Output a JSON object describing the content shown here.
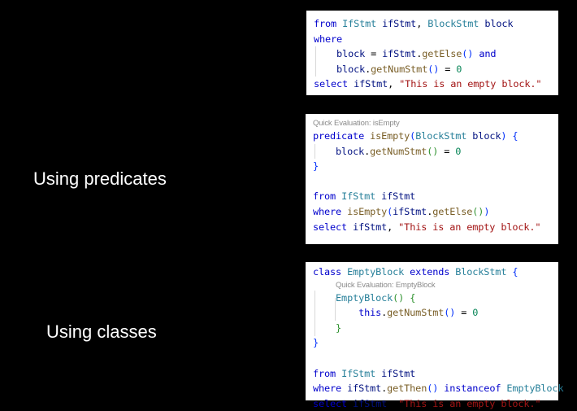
{
  "labels": {
    "predicates": "Using predicates",
    "classes": "Using classes"
  },
  "panel1": {
    "lines": [
      [
        [
          "kw",
          "from"
        ],
        [
          "op",
          " "
        ],
        [
          "ty",
          "IfStmt"
        ],
        [
          "op",
          " "
        ],
        [
          "id",
          "ifStmt"
        ],
        [
          "op",
          ", "
        ],
        [
          "ty",
          "BlockStmt"
        ],
        [
          "op",
          " "
        ],
        [
          "id",
          "block"
        ]
      ],
      [
        [
          "kw",
          "where"
        ]
      ],
      [
        [
          "op",
          "    "
        ],
        [
          "id",
          "block"
        ],
        [
          "op",
          " = "
        ],
        [
          "id",
          "ifStmt"
        ],
        [
          "op",
          "."
        ],
        [
          "fn",
          "getElse"
        ],
        [
          "b1",
          "()"
        ],
        [
          "op",
          " "
        ],
        [
          "kw",
          "and"
        ]
      ],
      [
        [
          "op",
          "    "
        ],
        [
          "id",
          "block"
        ],
        [
          "op",
          "."
        ],
        [
          "fn",
          "getNumStmt"
        ],
        [
          "b1",
          "()"
        ],
        [
          "op",
          " = "
        ],
        [
          "num",
          "0"
        ]
      ],
      [
        [
          "kw",
          "select"
        ],
        [
          "op",
          " "
        ],
        [
          "id",
          "ifStmt"
        ],
        [
          "op",
          ", "
        ],
        [
          "str",
          "\"This is an empty block.\""
        ]
      ]
    ]
  },
  "panel2": {
    "lens": "Quick Evaluation: isEmpty",
    "lines": [
      [
        [
          "kw",
          "predicate"
        ],
        [
          "op",
          " "
        ],
        [
          "fn",
          "isEmpty"
        ],
        [
          "b1",
          "("
        ],
        [
          "ty",
          "BlockStmt"
        ],
        [
          "op",
          " "
        ],
        [
          "id",
          "block"
        ],
        [
          "b1",
          ")"
        ],
        [
          "op",
          " "
        ],
        [
          "b1",
          "{"
        ]
      ],
      [
        [
          "op",
          "    "
        ],
        [
          "id",
          "block"
        ],
        [
          "op",
          "."
        ],
        [
          "fn",
          "getNumStmt"
        ],
        [
          "b2",
          "()"
        ],
        [
          "op",
          " = "
        ],
        [
          "num",
          "0"
        ]
      ],
      [
        [
          "b1",
          "}"
        ]
      ],
      [
        [
          "op",
          ""
        ]
      ],
      [
        [
          "kw",
          "from"
        ],
        [
          "op",
          " "
        ],
        [
          "ty",
          "IfStmt"
        ],
        [
          "op",
          " "
        ],
        [
          "id",
          "ifStmt"
        ]
      ],
      [
        [
          "kw",
          "where"
        ],
        [
          "op",
          " "
        ],
        [
          "fn",
          "isEmpty"
        ],
        [
          "b1",
          "("
        ],
        [
          "id",
          "ifStmt"
        ],
        [
          "op",
          "."
        ],
        [
          "fn",
          "getElse"
        ],
        [
          "b2",
          "()"
        ],
        [
          "b1",
          ")"
        ]
      ],
      [
        [
          "kw",
          "select"
        ],
        [
          "op",
          " "
        ],
        [
          "id",
          "ifStmt"
        ],
        [
          "op",
          ", "
        ],
        [
          "str",
          "\"This is an empty block.\""
        ]
      ]
    ]
  },
  "panel3": {
    "lens": "Quick Evaluation: EmptyBlock",
    "lines": [
      [
        [
          "kw",
          "class"
        ],
        [
          "op",
          " "
        ],
        [
          "ty",
          "EmptyBlock"
        ],
        [
          "op",
          " "
        ],
        [
          "kw",
          "extends"
        ],
        [
          "op",
          " "
        ],
        [
          "ty",
          "BlockStmt"
        ],
        [
          "op",
          " "
        ],
        [
          "b1",
          "{"
        ]
      ],
      [
        [
          "op",
          "    "
        ],
        [
          "ty",
          "EmptyBlock"
        ],
        [
          "b2",
          "()"
        ],
        [
          "op",
          " "
        ],
        [
          "b2",
          "{"
        ]
      ],
      [
        [
          "op",
          "        "
        ],
        [
          "kw",
          "this"
        ],
        [
          "op",
          "."
        ],
        [
          "fn",
          "getNumStmt"
        ],
        [
          "b1",
          "()"
        ],
        [
          "op",
          " = "
        ],
        [
          "num",
          "0"
        ]
      ],
      [
        [
          "op",
          "    "
        ],
        [
          "b2",
          "}"
        ]
      ],
      [
        [
          "b1",
          "}"
        ]
      ],
      [
        [
          "op",
          ""
        ]
      ],
      [
        [
          "kw",
          "from"
        ],
        [
          "op",
          " "
        ],
        [
          "ty",
          "IfStmt"
        ],
        [
          "op",
          " "
        ],
        [
          "id",
          "ifStmt"
        ]
      ],
      [
        [
          "kw",
          "where"
        ],
        [
          "op",
          " "
        ],
        [
          "id",
          "ifStmt"
        ],
        [
          "op",
          "."
        ],
        [
          "fn",
          "getThen"
        ],
        [
          "b1",
          "()"
        ],
        [
          "op",
          " "
        ],
        [
          "kw",
          "instanceof"
        ],
        [
          "op",
          " "
        ],
        [
          "ty",
          "EmptyBlock"
        ]
      ],
      [
        [
          "kw",
          "select"
        ],
        [
          "op",
          " "
        ],
        [
          "id",
          "ifStmt"
        ],
        [
          "op",
          ", "
        ],
        [
          "str",
          "\"This is an empty block.\""
        ]
      ]
    ]
  }
}
